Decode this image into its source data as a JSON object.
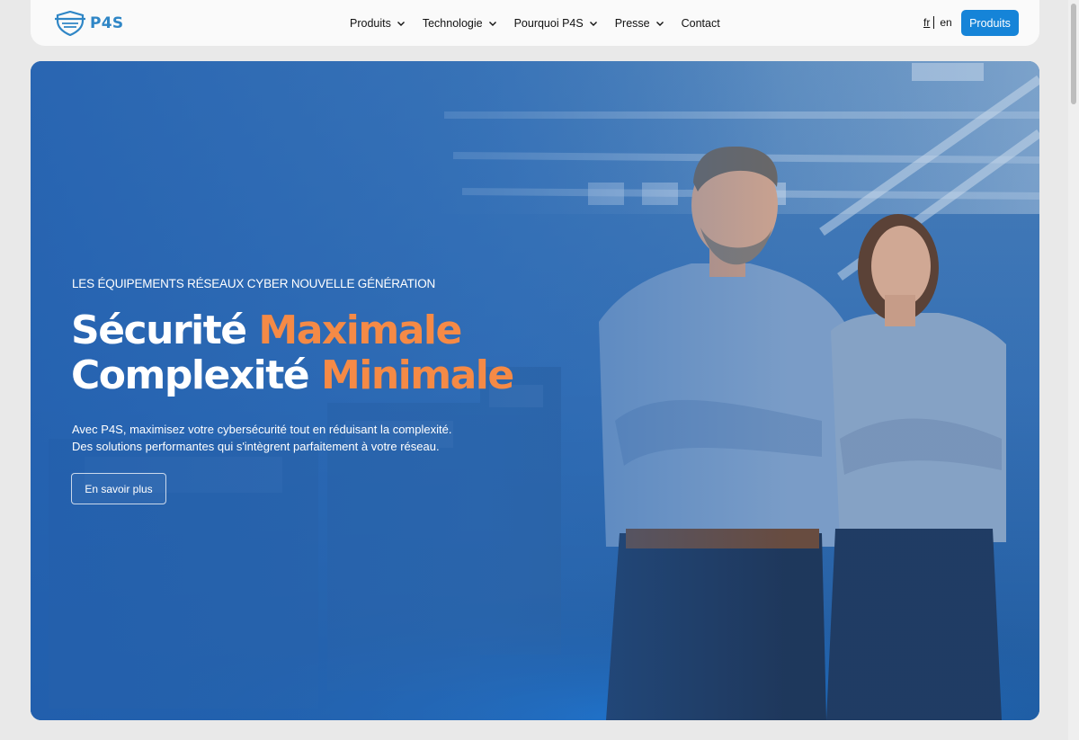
{
  "brand": {
    "name": "P4S",
    "color": "#2f86c6"
  },
  "nav": {
    "items": [
      {
        "label": "Produits",
        "has_dropdown": true
      },
      {
        "label": "Technologie",
        "has_dropdown": true
      },
      {
        "label": "Pourquoi P4S",
        "has_dropdown": true
      },
      {
        "label": "Presse",
        "has_dropdown": true
      },
      {
        "label": "Contact",
        "has_dropdown": false
      }
    ]
  },
  "language": {
    "current": "fr",
    "other": "en"
  },
  "header_cta": {
    "label": "Produits",
    "color": "#1584d8"
  },
  "hero": {
    "eyebrow": "LES ÉQUIPEMENTS RÉSEAUX CYBER NOUVELLE GÉNÉRATION",
    "headline_line1": {
      "prefix": "Sécurité",
      "accent": "Maximale"
    },
    "headline_line2": {
      "prefix": "Complexité",
      "accent": "Minimale"
    },
    "accent_color": "#f58a46",
    "description_line1": "Avec P4S, maximisez votre cybersécurité tout en réduisant la complexité.",
    "description_line2": "Des solutions performantes qui s'intègrent parfaitement à votre réseau.",
    "button_label": "En savoir plus"
  },
  "icons": [
    "shield-logo-icon",
    "chevron-down-icon"
  ]
}
